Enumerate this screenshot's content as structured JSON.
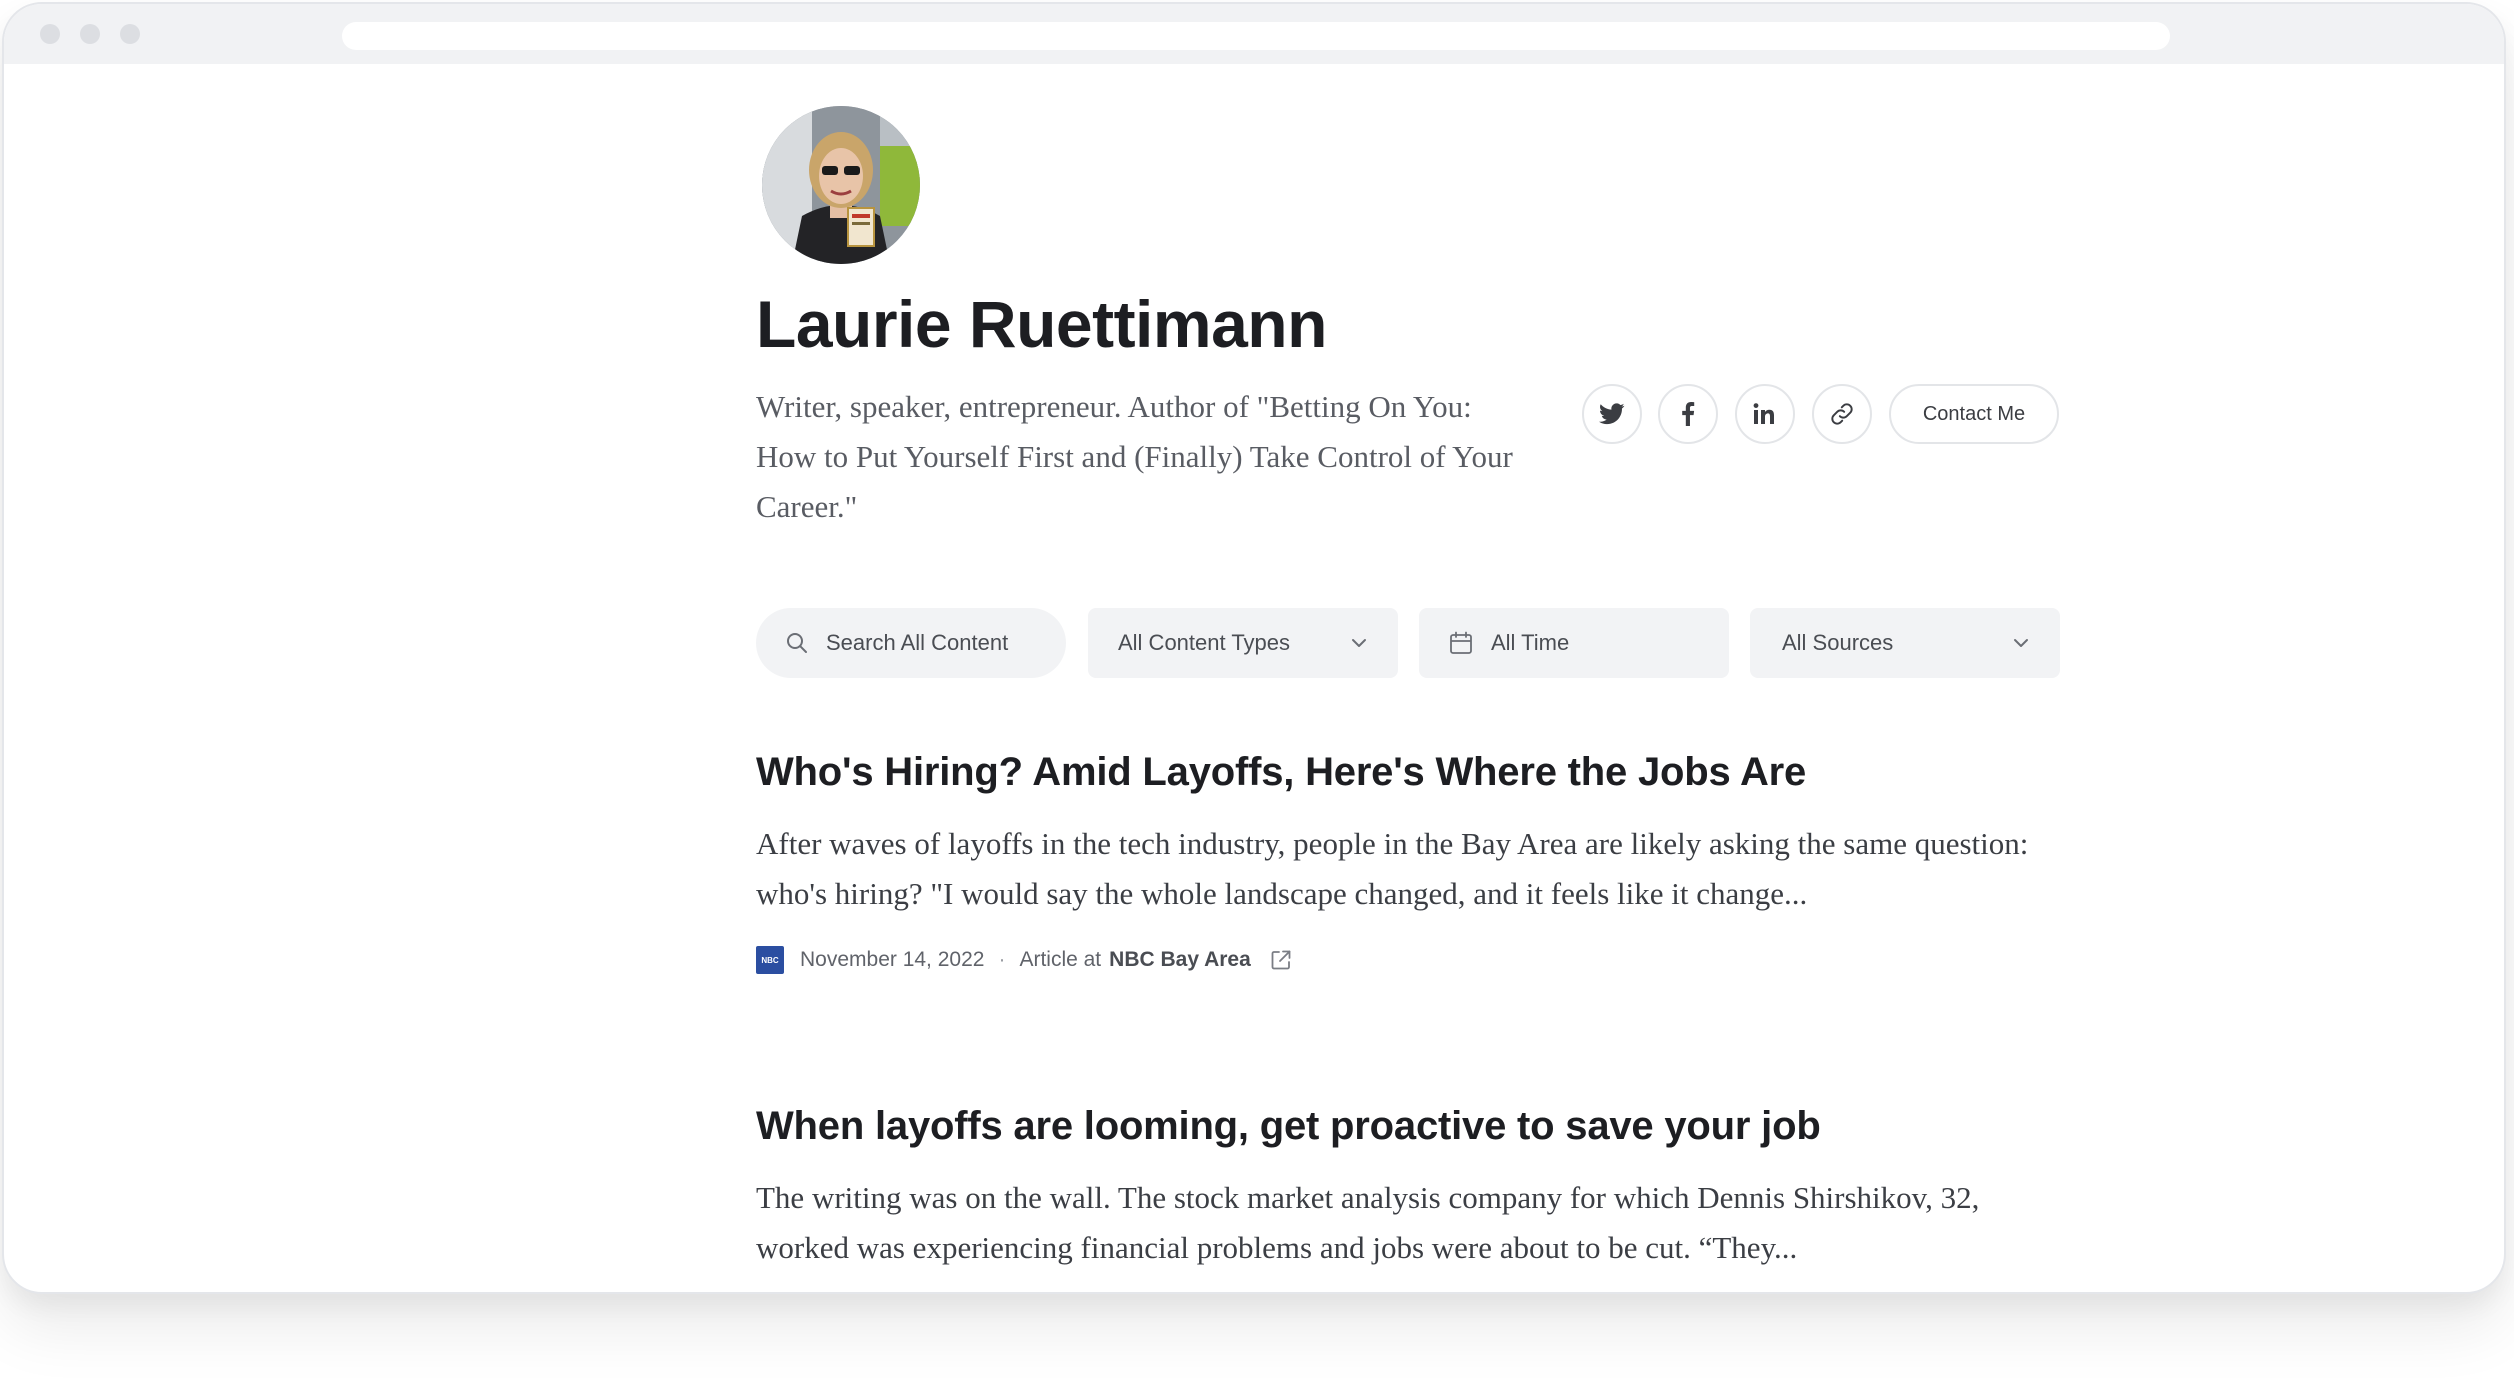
{
  "profile": {
    "name": "Laurie Ruettimann",
    "bio": "Writer, speaker, entrepreneur. Author of \"Betting On You: How to Put Yourself First and (Finally) Take Control of Your Career.\"",
    "contact_label": "Contact Me"
  },
  "social": [
    {
      "icon": "twitter-icon"
    },
    {
      "icon": "facebook-icon"
    },
    {
      "icon": "linkedin-icon"
    },
    {
      "icon": "link-icon"
    }
  ],
  "filters": {
    "search_placeholder": "Search All Content",
    "content_types": "All Content Types",
    "time": "All Time",
    "sources": "All Sources"
  },
  "articles": [
    {
      "title": "Who's Hiring? Amid Layoffs, Here's Where the Jobs Are",
      "excerpt": "After waves of layoffs in the tech industry, people in the Bay Area are likely asking the same question: who's hiring? \"I would say the whole landscape changed, and it feels like it change...",
      "date": "November 14, 2022",
      "type_prefix": "Article at",
      "source": "NBC Bay Area"
    },
    {
      "title": "When layoffs are looming, get proactive to save your job",
      "excerpt": "The writing was on the wall. The stock market analysis company for which Dennis Shirshikov, 32, worked was experiencing financial problems and jobs were about to be cut. “They..."
    }
  ],
  "colors": {
    "text_dark": "#1d1e22",
    "text_muted": "#595c63",
    "filter_bg": "#f2f3f5",
    "border": "#e3e5e8",
    "source_logo": "#2b4ea1"
  }
}
